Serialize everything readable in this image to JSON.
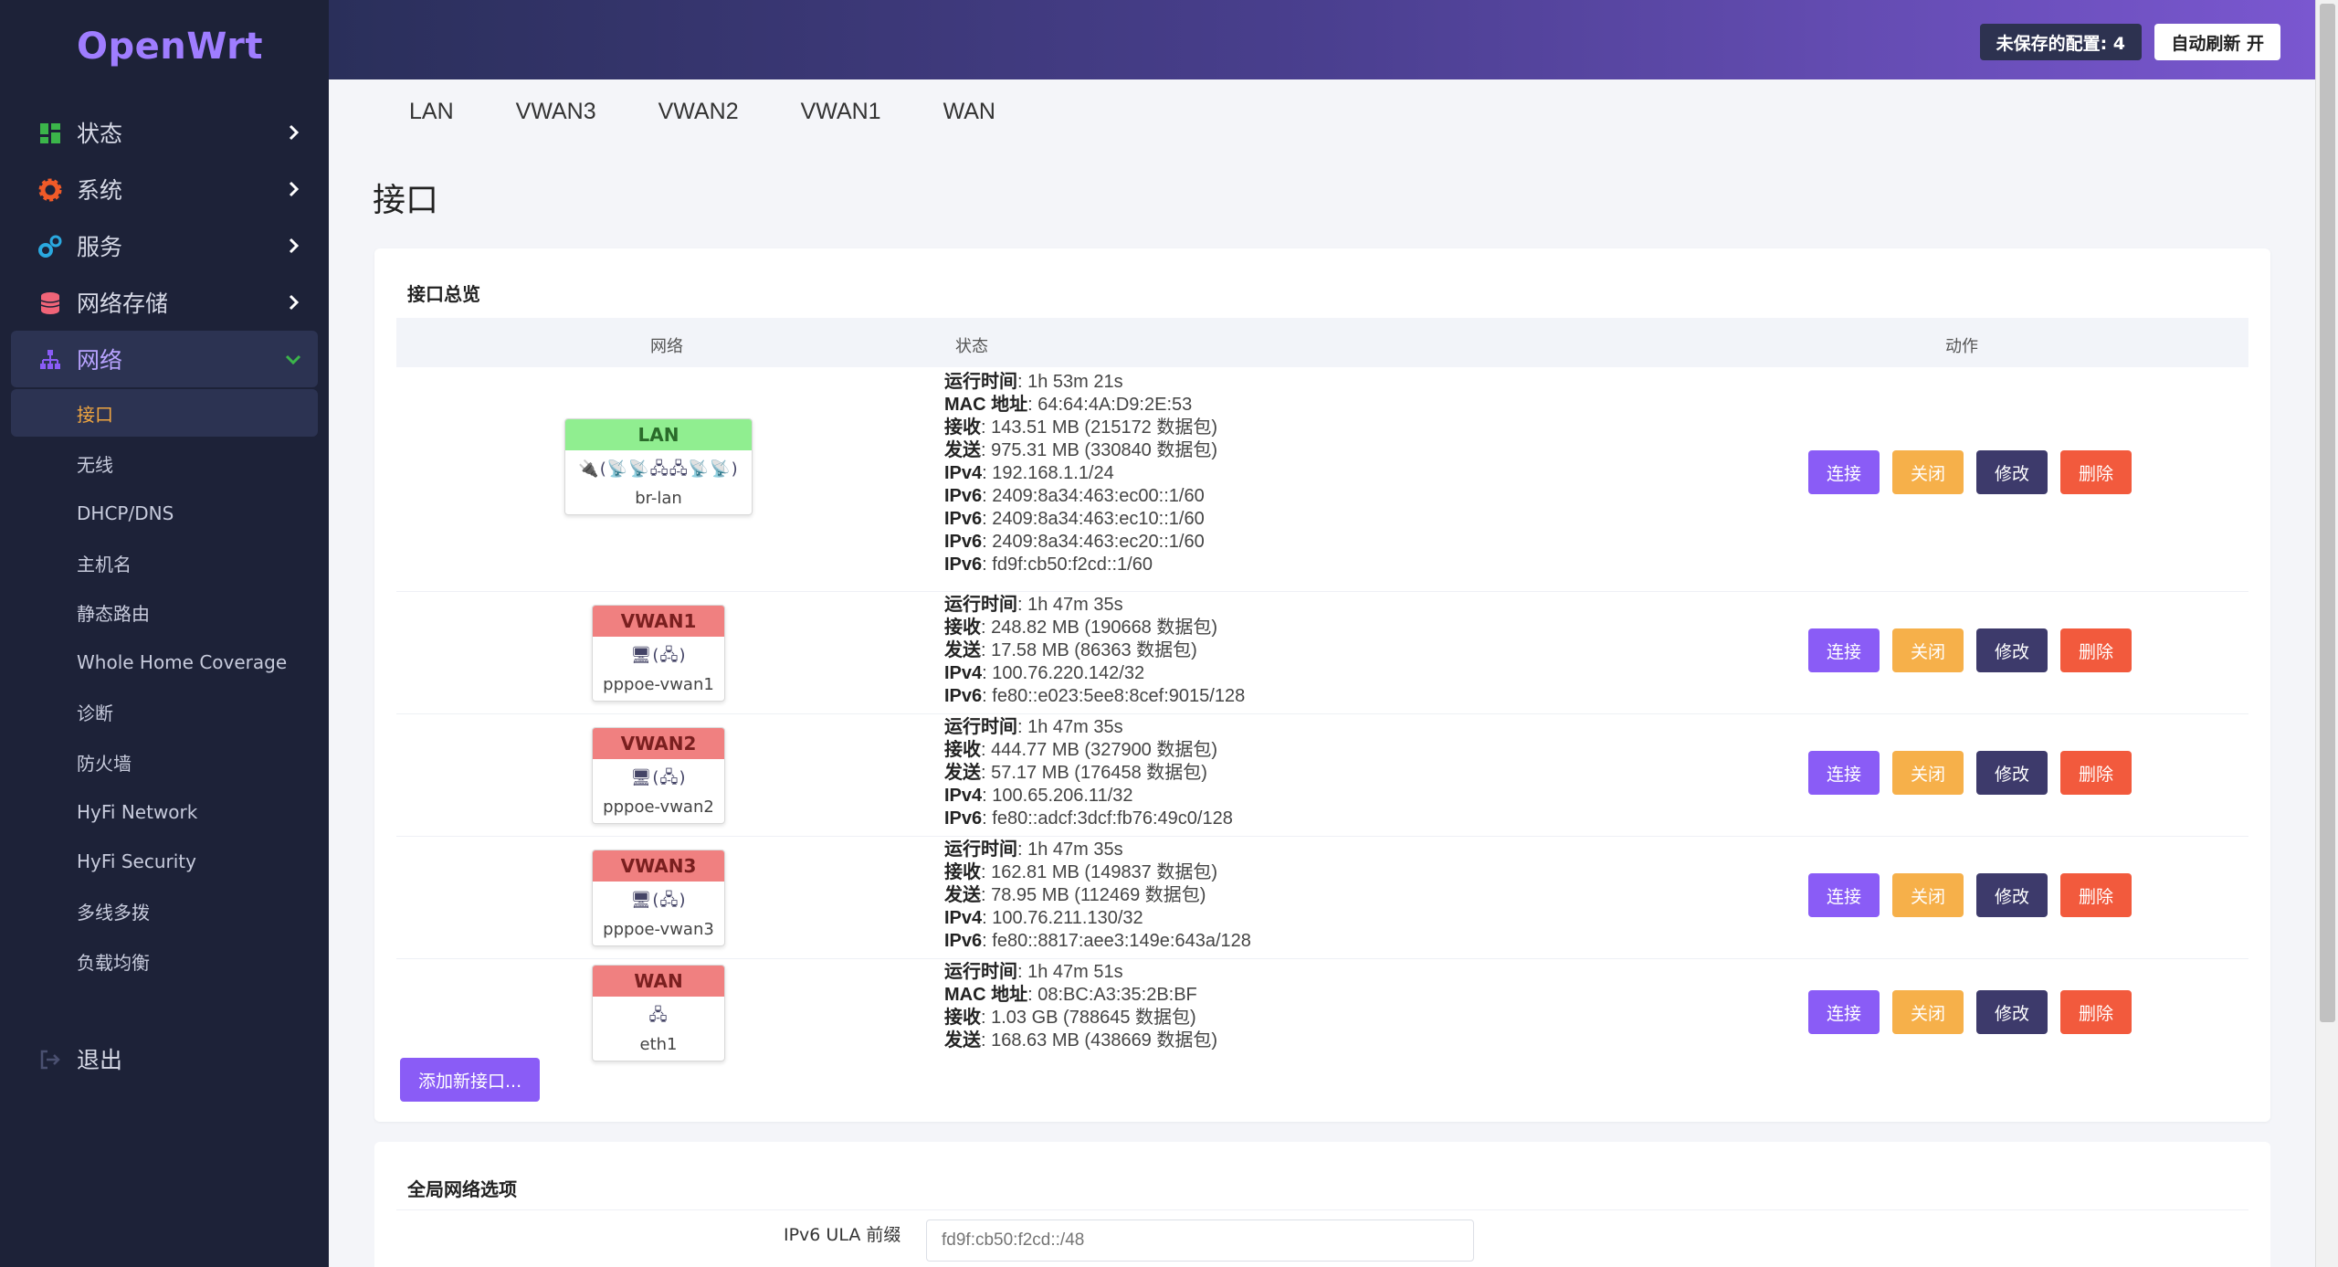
{
  "app": {
    "logo": "OpenWrt"
  },
  "sidebar": {
    "menu": [
      {
        "label": "状态",
        "icon": "dashboard-icon",
        "color": "#3bb54a"
      },
      {
        "label": "系统",
        "icon": "gear-icon",
        "color": "#f05a28"
      },
      {
        "label": "服务",
        "icon": "services-icon",
        "color": "#2aa9e0"
      },
      {
        "label": "网络存储",
        "icon": "database-icon",
        "color": "#f06478"
      }
    ],
    "active": {
      "label": "网络",
      "icon": "network-icon",
      "color": "#8a5cf6"
    },
    "sub_items": [
      "接口",
      "无线",
      "DHCP/DNS",
      "主机名",
      "静态路由",
      "Whole Home Coverage",
      "诊断",
      "防火墙",
      "HyFi Network",
      "HyFi Security",
      "多线多拨",
      "负载均衡"
    ],
    "logout": "退出"
  },
  "header": {
    "unsaved": "未保存的配置: 4",
    "autorefresh": "自动刷新 开"
  },
  "tabs": [
    "LAN",
    "VWAN3",
    "VWAN2",
    "VWAN1",
    "WAN"
  ],
  "page_title": "接口",
  "overview": {
    "title": "接口总览",
    "columns": {
      "network": "网络",
      "status": "状态",
      "actions": "动作"
    },
    "buttons": {
      "connect": "连接",
      "close": "关闭",
      "edit": "修改",
      "delete": "删除"
    },
    "rows": [
      {
        "name": "LAN",
        "color": "green",
        "icons": "🔌(📡📡🖧🖧📡📡)",
        "device": "br-lan",
        "status": [
          [
            "运行时间",
            "1h 53m 21s"
          ],
          [
            "MAC 地址",
            "64:64:4A:D9:2E:53"
          ],
          [
            "接收",
            "143.51 MB (215172 数据包)"
          ],
          [
            "发送",
            "975.31 MB (330840 数据包)"
          ],
          [
            "IPv4",
            "192.168.1.1/24"
          ],
          [
            "IPv6",
            "2409:8a34:463:ec00::1/60"
          ],
          [
            "IPv6",
            "2409:8a34:463:ec10::1/60"
          ],
          [
            "IPv6",
            "2409:8a34:463:ec20::1/60"
          ],
          [
            "IPv6",
            "fd9f:cb50:f2cd::1/60"
          ]
        ]
      },
      {
        "name": "VWAN1",
        "color": "red",
        "icons": "🖥(🖧)",
        "device": "pppoe-vwan1",
        "status": [
          [
            "运行时间",
            "1h 47m 35s"
          ],
          [
            "接收",
            "248.82 MB (190668 数据包)"
          ],
          [
            "发送",
            "17.58 MB (86363 数据包)"
          ],
          [
            "IPv4",
            "100.76.220.142/32"
          ],
          [
            "IPv6",
            "fe80::e023:5ee8:8cef:9015/128"
          ]
        ]
      },
      {
        "name": "VWAN2",
        "color": "red",
        "icons": "🖥(🖧)",
        "device": "pppoe-vwan2",
        "status": [
          [
            "运行时间",
            "1h 47m 35s"
          ],
          [
            "接收",
            "444.77 MB (327900 数据包)"
          ],
          [
            "发送",
            "57.17 MB (176458 数据包)"
          ],
          [
            "IPv4",
            "100.65.206.11/32"
          ],
          [
            "IPv6",
            "fe80::adcf:3dcf:fb76:49c0/128"
          ]
        ]
      },
      {
        "name": "VWAN3",
        "color": "red",
        "icons": "🖥(🖧)",
        "device": "pppoe-vwan3",
        "status": [
          [
            "运行时间",
            "1h 47m 35s"
          ],
          [
            "接收",
            "162.81 MB (149837 数据包)"
          ],
          [
            "发送",
            "78.95 MB (112469 数据包)"
          ],
          [
            "IPv4",
            "100.76.211.130/32"
          ],
          [
            "IPv6",
            "fe80::8817:aee3:149e:643a/128"
          ]
        ]
      },
      {
        "name": "WAN",
        "color": "red",
        "icons": "🖧",
        "device": "eth1",
        "status": [
          [
            "运行时间",
            "1h 47m 51s"
          ],
          [
            "MAC 地址",
            "08:BC:A3:35:2B:BF"
          ],
          [
            "接收",
            "1.03 GB (788645 数据包)"
          ],
          [
            "发送",
            "168.63 MB (438669 数据包)"
          ]
        ]
      }
    ],
    "add_button": "添加新接口..."
  },
  "global": {
    "title": "全局网络选项",
    "ula_label": "IPv6 ULA 前缀",
    "ula_value": "fd9f:cb50:f2cd::/48"
  }
}
